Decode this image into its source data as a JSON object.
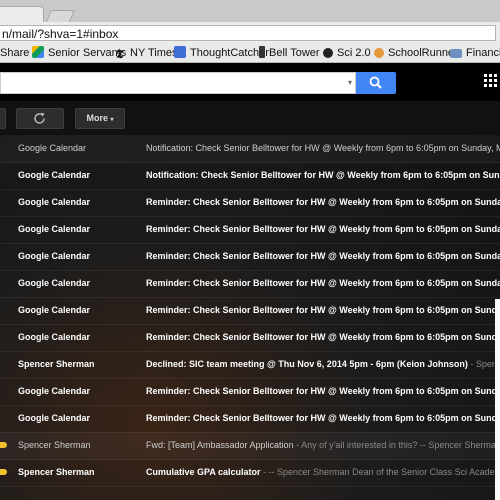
{
  "browser": {
    "url": "n/mail/?shva=1#inbox",
    "bookmarks": [
      {
        "label": "Share",
        "icon": "none"
      },
      {
        "label": "Senior Servants",
        "icon": "google-drive-icon"
      },
      {
        "label": "NY Times",
        "icon": "nytimes-icon"
      },
      {
        "label": "ThoughtCatcher",
        "icon": "thoughtcatcher-icon"
      },
      {
        "label": "Bell Tower",
        "icon": "belltower-icon"
      },
      {
        "label": "Sci 2.0",
        "icon": "github-icon"
      },
      {
        "label": "SchoolRunner",
        "icon": "schoolrunner-icon"
      },
      {
        "label": "Financial",
        "icon": "folder-icon"
      }
    ]
  },
  "toolbar": {
    "more_label": "More",
    "refresh_icon": "refresh-icon"
  },
  "inbox": {
    "rows": [
      {
        "sender": "Google Calendar",
        "subject": "Notification: Check Senior Belltower for HW @ Weekly from 6pm to 6:05pm on Sunday, Mon",
        "snippet": "",
        "read": true,
        "important": false
      },
      {
        "sender": "Google Calendar",
        "subject": "Notification: Check Senior Belltower for HW @ Weekly from 6pm to 6:05pm on Sunday,",
        "snippet": "",
        "read": false,
        "important": false
      },
      {
        "sender": "Google Calendar",
        "subject": "Reminder: Check Senior Belltower for HW @ Weekly from 6pm to 6:05pm on Sunday, M",
        "snippet": "",
        "read": false,
        "important": false
      },
      {
        "sender": "Google Calendar",
        "subject": "Reminder: Check Senior Belltower for HW @ Weekly from 6pm to 6:05pm on Sunday, M",
        "snippet": "",
        "read": false,
        "important": false
      },
      {
        "sender": "Google Calendar",
        "subject": "Reminder: Check Senior Belltower for HW @ Weekly from 6pm to 6:05pm on Sunday, M",
        "snippet": "",
        "read": false,
        "important": false
      },
      {
        "sender": "Google Calendar",
        "subject": "Reminder: Check Senior Belltower for HW @ Weekly from 6pm to 6:05pm on Sunday,",
        "snippet": "",
        "read": false,
        "important": false
      },
      {
        "sender": "Google Calendar",
        "subject": "Reminder: Check Senior Belltower for HW @ Weekly from 6pm to 6:05pm on Sunday,",
        "snippet": "",
        "read": false,
        "important": false
      },
      {
        "sender": "Google Calendar",
        "subject": "Reminder: Check Senior Belltower for HW @ Weekly from 6pm to 6:05pm on Sunday,",
        "snippet": "",
        "read": false,
        "important": false
      },
      {
        "sender": "Spencer Sherman",
        "subject": "Declined: SIC team meeting @ Thu Nov 6, 2014 5pm - 6pm (Keion Johnson)",
        "snippet": " - Spencer",
        "read": false,
        "important": false
      },
      {
        "sender": "Google Calendar",
        "subject": "Reminder: Check Senior Belltower for HW @ Weekly from 6pm to 6:05pm on Sunday,",
        "snippet": "",
        "read": false,
        "important": false
      },
      {
        "sender": "Google Calendar",
        "subject": "Reminder: Check Senior Belltower for HW @ Weekly from 6pm to 6:05pm on Sunday,",
        "snippet": "",
        "read": false,
        "important": false
      },
      {
        "sender": "Spencer Sherman",
        "subject": "Fwd: [Team] Ambassador Application",
        "snippet": " - Any of y'all interested in this? -- Spencer Sherman D",
        "read": true,
        "important": true
      },
      {
        "sender": "Spencer Sherman",
        "subject": "Cumulative GPA calculator",
        "snippet": " - -- Spencer Sherman Dean of the Senior Class Sci Academy",
        "read": false,
        "important": true
      }
    ]
  },
  "colors": {
    "search_button": "#4285f4",
    "important_marker": "#f2c12e"
  }
}
